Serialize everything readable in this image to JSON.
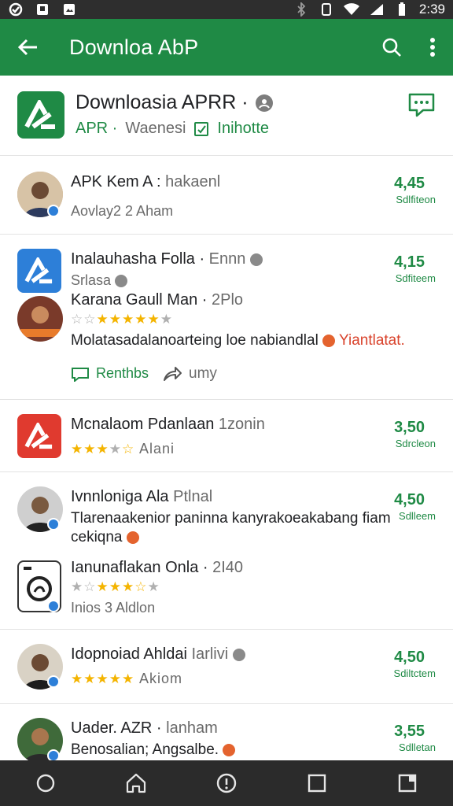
{
  "status_bar": {
    "time": "2:39"
  },
  "app_bar": {
    "title": "Downloa AbP"
  },
  "header": {
    "title": "Downloasia APRR ·",
    "sub_tag": "APR ·",
    "sub_text": "Waenesi",
    "sub_link": "Inihotte"
  },
  "rows": [
    {
      "title": "APK Kem A :",
      "title_muted": "hakaenl",
      "sub": "Aovlay2 2 Aham",
      "count": "4,45",
      "count_sub": "Sdlfiteon"
    },
    {
      "title": "Inalauhasha Folla ·",
      "title_muted": "Ennn",
      "sub": "Srlasa",
      "count": "4,15",
      "count_sub": "Sdfiteem",
      "nested_title": "Karana Gaull Man ·",
      "nested_title_muted": "2Plo",
      "message": "Molatasadalanoarteing loe nabiandlal",
      "message_tail": "Yiantlatat.",
      "action1": "Renthbs",
      "action2": "umy"
    },
    {
      "title": "Mcnalaom Pdanlaan",
      "title_muted": "1zonin",
      "sub": "Alani",
      "count": "3,50",
      "count_sub": "Sdrcleon"
    },
    {
      "title": "Ivnnloniga Ala",
      "title_muted": "Ptlnal",
      "line2": "Tlarenaakenior paninna kanyrakoeakabang fiam",
      "line3": "cekiqna",
      "count": "4,50",
      "count_sub": "Sdlleem",
      "nested_title": "Ianunaflakan Onla ·",
      "nested_title_muted": "2I40",
      "nested_sub": "Inios 3 Aldlon"
    },
    {
      "title": "Idopnoiad Ahldai",
      "title_muted": "Iarlivi",
      "sub": "Akiom",
      "count": "4,50",
      "count_sub": "Sdiltctem"
    },
    {
      "title": "Uader. AZR ·",
      "title_muted": "lanham",
      "sub": "Benosalian; Angsalbe.",
      "count": "3,55",
      "count_sub": "Sdlletan"
    }
  ],
  "colors": {
    "brand": "#1f8a45",
    "accent_blue": "#2d7fd8",
    "alert_red": "#e03a2f",
    "star": "#f4b400"
  }
}
